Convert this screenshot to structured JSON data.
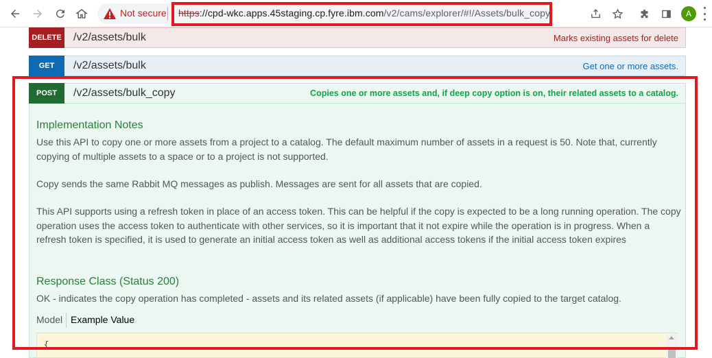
{
  "browser": {
    "security_label": "Not secure",
    "url_scheme": "https",
    "url_host": "://cpd-wkc.apps.45staging.cp.fyre.ibm.com",
    "url_path": "/v2/cams/explorer/#!/Assets/bulk_copy",
    "avatar_letter": "A",
    "icons": [
      "back-icon",
      "forward-icon",
      "reload-icon",
      "home-icon",
      "warning-icon",
      "share-icon",
      "star-icon",
      "extensions-icon",
      "sidepanel-icon",
      "menu-icon"
    ]
  },
  "operations": [
    {
      "method": "DELETE",
      "path": "/v2/assets/bulk",
      "summary": "Marks existing assets for delete",
      "color": "#a41e22"
    },
    {
      "method": "GET",
      "path": "/v2/assets/bulk",
      "summary": "Get one or more assets.",
      "color": "#0f6ab4"
    },
    {
      "method": "POST",
      "path": "/v2/assets/bulk_copy",
      "summary": "Copies one or more assets and, if deep copy option is on, their related assets to a catalog.",
      "color": "#10a54a"
    }
  ],
  "post_details": {
    "impl_heading": "Implementation Notes",
    "paragraphs": [
      "Use this API to copy one or more assets from a project to a catalog. The default maximum number of assets in a request is 50. Note that, currently copying of multiple assets to a space or to a project is not supported.",
      "Copy sends the same Rabbit MQ messages as publish. Messages are sent for all assets that are copied.",
      "This API supports using a refresh token in place of an access token. This can be helpful if the copy is expected to be a long running operation. The copy operation uses the access token to authenticate with other services, so it is important that it not expire while the operation is in progress. When a refresh token is specified, it is used to generate an initial access token as well as additional access tokens if the initial access token expires"
    ],
    "response_heading": "Response Class (Status 200)",
    "response_text": "OK - indicates the copy operation has completed - assets and its related assets (if applicable) have been fully copied to the target catalog.",
    "tab_model": "Model",
    "tab_example": "Example Value",
    "sample_first_line": "{"
  }
}
